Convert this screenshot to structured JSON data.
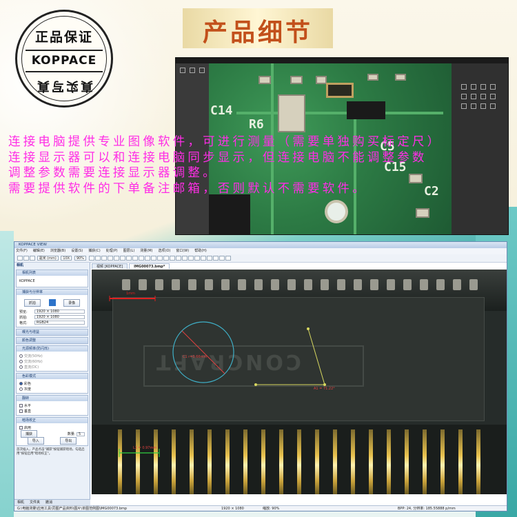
{
  "seal": {
    "top_text": "正品保证",
    "middle_text": "KOPPACE",
    "bottom_text": "真实写真"
  },
  "title": "产品细节",
  "overlay_lines": [
    "连接电脑提供专业图像软件，可进行测量（需要单独购买标定尺）",
    "连接显示器可以和连接电脑同步显示，但连接电脑不能调整参数",
    "调整参数需要连接显示器调整。",
    "需要提供软件的下单备注邮箱，否则默认不需要软件。"
  ],
  "colors": {
    "overlay_text": "#ff2de6",
    "title_text": "#c2501b",
    "teal": "#3aa8a5"
  },
  "top_screenshot": {
    "silk_labels": [
      "C14",
      "R6",
      "C5",
      "C15",
      "C2"
    ]
  },
  "software": {
    "window_title": "KOPPACE VIEW",
    "menu": [
      "文件(F)",
      "编辑(E)",
      "浏览器(B)",
      "设置(S)",
      "捕获(C)",
      "处理(P)",
      "图层(L)",
      "测量(M)",
      "选项(O)",
      "窗口(W)",
      "帮助(H)"
    ],
    "toolbar": {
      "unit": "毫米 (mm)",
      "magnification": "10X",
      "zoom": "90%"
    },
    "panel_title": "相机",
    "camera_list_header": "相机列表",
    "camera_name": "KOPPACE",
    "capture_section": "捕获与分辨率",
    "capture_button": "抓拍",
    "record_button": "录像",
    "preview_label": "预览:",
    "preview_value": "1920 × 1080",
    "snap_label": "抓拍:",
    "snap_value": "1920 × 1080",
    "format_label": "格式:",
    "format_value": "RGB24",
    "sections": [
      "曝光与增益",
      "颜色调整",
      "光源频率(防闪烁)",
      "色彩模式",
      "翻转",
      "暗场校正"
    ],
    "freq_options": [
      "交流(50Hz)",
      "交流(60Hz)",
      "直流(DC)"
    ],
    "color_options": [
      "彩色",
      "灰度"
    ],
    "flip_options": [
      "水平",
      "垂直"
    ],
    "dark_enable": "启用",
    "dark_count_label": "数量:",
    "dark_count_value": "5",
    "dark_capture": "捕获",
    "import_button": "导入",
    "export_button": "导出",
    "note": "首次插入，产品点击\"捕获\"按钮捕获暗场。勾选启用\"按钮启用\"暗场校正\"。",
    "bottom_tabs": [
      "相机",
      "文件夹",
      "撤消"
    ],
    "tabs": [
      "视频 [KOPPACE]",
      "IMG00073.bmp*"
    ],
    "measurements": [
      "1mm",
      "C1 r=0.66mm",
      "A1 = 71.22°",
      "L1 = 0.97mm"
    ],
    "embossed_text": "CONCRAFT",
    "status_left": "G:\\电脑测量\\应用工具\\同图产品资料\\图片\\单图范例图\\IMG00073.bmp",
    "status_res": "1920 × 1080",
    "status_zoom": "缩放: 90%",
    "status_right": "BPP: 24, 分辨率: 185.55888 p/mm"
  }
}
